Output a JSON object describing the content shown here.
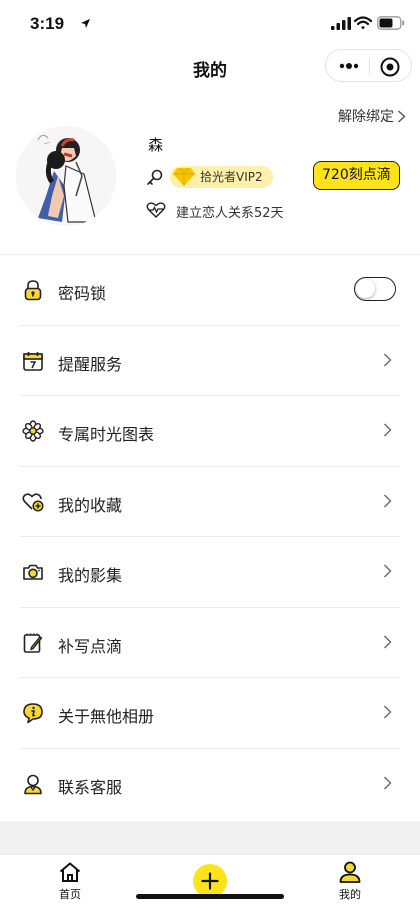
{
  "status_bar": {
    "time": "3:19"
  },
  "nav": {
    "title": "我的"
  },
  "profile": {
    "unbind_label": "解除绑定",
    "name": "森",
    "vip_label": "拾光者VIP2",
    "points_label": "720刻点滴",
    "relation_text": "建立恋人关系52天"
  },
  "menu": {
    "items": [
      {
        "label": "密码锁",
        "icon": "lock-icon",
        "toggle_on": false
      },
      {
        "label": "提醒服务",
        "icon": "calendar-icon"
      },
      {
        "label": "专属时光图表",
        "icon": "flower-icon"
      },
      {
        "label": "我的收藏",
        "icon": "heart-plus-icon"
      },
      {
        "label": "我的影集",
        "icon": "camera-icon"
      },
      {
        "label": "补写点滴",
        "icon": "notepad-pen-icon"
      },
      {
        "label": "关于無他相册",
        "icon": "info-icon"
      },
      {
        "label": "联系客服",
        "icon": "customer-service-icon"
      }
    ]
  },
  "tab_bar": {
    "home_label": "首页",
    "mine_label": "我的"
  },
  "colors": {
    "accent_yellow": "#ffe21a",
    "vip_bg": "#fdf0a8",
    "icon_yellow": "#f7d730",
    "text": "#222222",
    "divider": "#ececec"
  }
}
